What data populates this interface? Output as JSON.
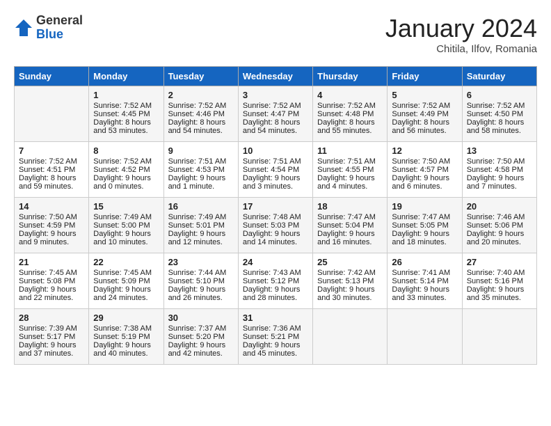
{
  "header": {
    "logo_general": "General",
    "logo_blue": "Blue",
    "month_title": "January 2024",
    "location": "Chitila, Ilfov, Romania"
  },
  "days_of_week": [
    "Sunday",
    "Monday",
    "Tuesday",
    "Wednesday",
    "Thursday",
    "Friday",
    "Saturday"
  ],
  "weeks": [
    [
      {
        "day": "",
        "info": ""
      },
      {
        "day": "1",
        "info": "Sunrise: 7:52 AM\nSunset: 4:45 PM\nDaylight: 8 hours\nand 53 minutes."
      },
      {
        "day": "2",
        "info": "Sunrise: 7:52 AM\nSunset: 4:46 PM\nDaylight: 8 hours\nand 54 minutes."
      },
      {
        "day": "3",
        "info": "Sunrise: 7:52 AM\nSunset: 4:47 PM\nDaylight: 8 hours\nand 54 minutes."
      },
      {
        "day": "4",
        "info": "Sunrise: 7:52 AM\nSunset: 4:48 PM\nDaylight: 8 hours\nand 55 minutes."
      },
      {
        "day": "5",
        "info": "Sunrise: 7:52 AM\nSunset: 4:49 PM\nDaylight: 8 hours\nand 56 minutes."
      },
      {
        "day": "6",
        "info": "Sunrise: 7:52 AM\nSunset: 4:50 PM\nDaylight: 8 hours\nand 58 minutes."
      }
    ],
    [
      {
        "day": "7",
        "info": "Sunrise: 7:52 AM\nSunset: 4:51 PM\nDaylight: 8 hours\nand 59 minutes."
      },
      {
        "day": "8",
        "info": "Sunrise: 7:52 AM\nSunset: 4:52 PM\nDaylight: 9 hours\nand 0 minutes."
      },
      {
        "day": "9",
        "info": "Sunrise: 7:51 AM\nSunset: 4:53 PM\nDaylight: 9 hours\nand 1 minute."
      },
      {
        "day": "10",
        "info": "Sunrise: 7:51 AM\nSunset: 4:54 PM\nDaylight: 9 hours\nand 3 minutes."
      },
      {
        "day": "11",
        "info": "Sunrise: 7:51 AM\nSunset: 4:55 PM\nDaylight: 9 hours\nand 4 minutes."
      },
      {
        "day": "12",
        "info": "Sunrise: 7:50 AM\nSunset: 4:57 PM\nDaylight: 9 hours\nand 6 minutes."
      },
      {
        "day": "13",
        "info": "Sunrise: 7:50 AM\nSunset: 4:58 PM\nDaylight: 9 hours\nand 7 minutes."
      }
    ],
    [
      {
        "day": "14",
        "info": "Sunrise: 7:50 AM\nSunset: 4:59 PM\nDaylight: 9 hours\nand 9 minutes."
      },
      {
        "day": "15",
        "info": "Sunrise: 7:49 AM\nSunset: 5:00 PM\nDaylight: 9 hours\nand 10 minutes."
      },
      {
        "day": "16",
        "info": "Sunrise: 7:49 AM\nSunset: 5:01 PM\nDaylight: 9 hours\nand 12 minutes."
      },
      {
        "day": "17",
        "info": "Sunrise: 7:48 AM\nSunset: 5:03 PM\nDaylight: 9 hours\nand 14 minutes."
      },
      {
        "day": "18",
        "info": "Sunrise: 7:47 AM\nSunset: 5:04 PM\nDaylight: 9 hours\nand 16 minutes."
      },
      {
        "day": "19",
        "info": "Sunrise: 7:47 AM\nSunset: 5:05 PM\nDaylight: 9 hours\nand 18 minutes."
      },
      {
        "day": "20",
        "info": "Sunrise: 7:46 AM\nSunset: 5:06 PM\nDaylight: 9 hours\nand 20 minutes."
      }
    ],
    [
      {
        "day": "21",
        "info": "Sunrise: 7:45 AM\nSunset: 5:08 PM\nDaylight: 9 hours\nand 22 minutes."
      },
      {
        "day": "22",
        "info": "Sunrise: 7:45 AM\nSunset: 5:09 PM\nDaylight: 9 hours\nand 24 minutes."
      },
      {
        "day": "23",
        "info": "Sunrise: 7:44 AM\nSunset: 5:10 PM\nDaylight: 9 hours\nand 26 minutes."
      },
      {
        "day": "24",
        "info": "Sunrise: 7:43 AM\nSunset: 5:12 PM\nDaylight: 9 hours\nand 28 minutes."
      },
      {
        "day": "25",
        "info": "Sunrise: 7:42 AM\nSunset: 5:13 PM\nDaylight: 9 hours\nand 30 minutes."
      },
      {
        "day": "26",
        "info": "Sunrise: 7:41 AM\nSunset: 5:14 PM\nDaylight: 9 hours\nand 33 minutes."
      },
      {
        "day": "27",
        "info": "Sunrise: 7:40 AM\nSunset: 5:16 PM\nDaylight: 9 hours\nand 35 minutes."
      }
    ],
    [
      {
        "day": "28",
        "info": "Sunrise: 7:39 AM\nSunset: 5:17 PM\nDaylight: 9 hours\nand 37 minutes."
      },
      {
        "day": "29",
        "info": "Sunrise: 7:38 AM\nSunset: 5:19 PM\nDaylight: 9 hours\nand 40 minutes."
      },
      {
        "day": "30",
        "info": "Sunrise: 7:37 AM\nSunset: 5:20 PM\nDaylight: 9 hours\nand 42 minutes."
      },
      {
        "day": "31",
        "info": "Sunrise: 7:36 AM\nSunset: 5:21 PM\nDaylight: 9 hours\nand 45 minutes."
      },
      {
        "day": "",
        "info": ""
      },
      {
        "day": "",
        "info": ""
      },
      {
        "day": "",
        "info": ""
      }
    ]
  ]
}
